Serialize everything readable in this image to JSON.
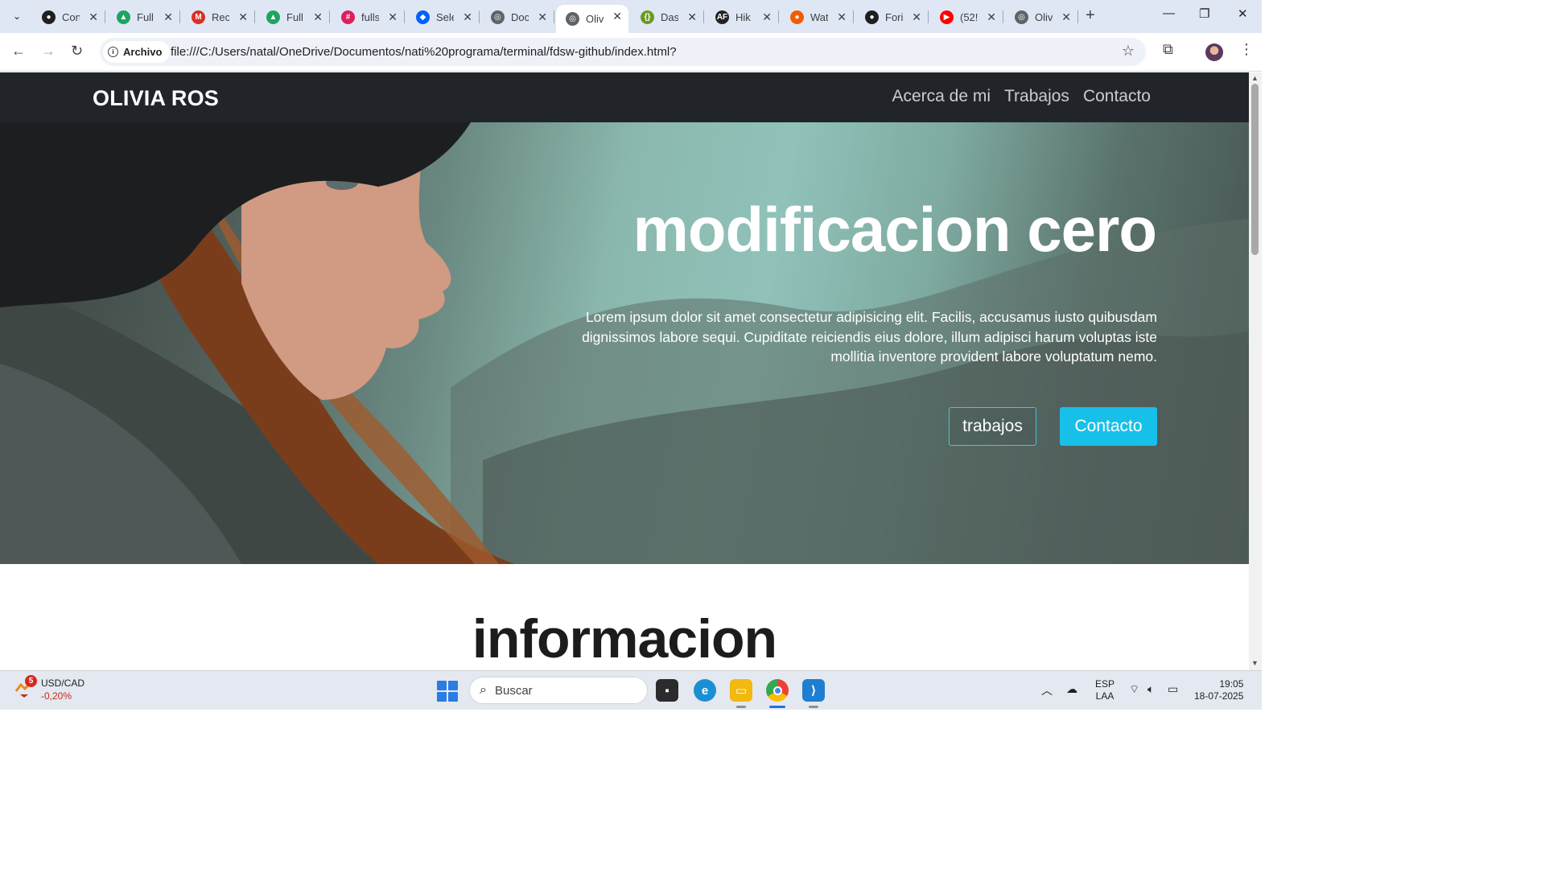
{
  "browser": {
    "tabs": [
      {
        "title": "Con",
        "icon": "github-icon",
        "color": "#1f1f1f",
        "glyph": "●"
      },
      {
        "title": "Full",
        "icon": "google-drive-icon",
        "color": "#1fa463",
        "glyph": "▲"
      },
      {
        "title": "Reci",
        "icon": "gmail-icon",
        "color": "#d93025",
        "glyph": "M"
      },
      {
        "title": "Full",
        "icon": "google-drive-icon",
        "color": "#1fa463",
        "glyph": "▲"
      },
      {
        "title": "fulls",
        "icon": "slack-icon",
        "color": "#e01e5a",
        "glyph": "#"
      },
      {
        "title": "Sele",
        "icon": "dropbox-icon",
        "color": "#0061fe",
        "glyph": "◆"
      },
      {
        "title": "Doc",
        "icon": "globe-icon",
        "color": "#5f6368",
        "glyph": "◎"
      },
      {
        "title": "Oliv",
        "icon": "globe-icon",
        "color": "#5f6368",
        "glyph": "◎",
        "active": true
      },
      {
        "title": "Das",
        "icon": "json-icon",
        "color": "#6a9a1f",
        "glyph": "{}"
      },
      {
        "title": "Hik",
        "icon": "af-icon",
        "color": "#222222",
        "glyph": "AF"
      },
      {
        "title": "Wat",
        "icon": "orange-circle-icon",
        "color": "#f25c05",
        "glyph": "●"
      },
      {
        "title": "Fori",
        "icon": "github-icon",
        "color": "#1f1f1f",
        "glyph": "●"
      },
      {
        "title": "(52!",
        "icon": "youtube-icon",
        "color": "#ff0000",
        "glyph": "▶"
      },
      {
        "title": "Oliv",
        "icon": "globe-icon",
        "color": "#5f6368",
        "glyph": "◎"
      }
    ],
    "security_chip": "Archivo",
    "url": "file:///C:/Users/natal/OneDrive/Documentos/nati%20programa/terminal/fdsw-github/index.html?"
  },
  "site": {
    "brand": "OLIVIA ROS",
    "nav": [
      "Acerca de mi",
      "Trabajos",
      "Contacto"
    ],
    "hero": {
      "title": "modificacion cero",
      "text": "Lorem ipsum dolor sit amet consectetur adipisicing elit. Facilis, accusamus iusto quibusdam dignissimos labore sequi. Cupiditate reiciendis eius dolore, illum adipisci harum voluptas iste mollitia inventore provident labore voluptatum nemo.",
      "btn_outline": "trabajos",
      "btn_fill": "Contacto",
      "accent": "#17c0e8"
    },
    "section_title": "informacion"
  },
  "taskbar": {
    "widget": {
      "badge": "5",
      "pair": "USD/CAD",
      "change": "-0,20%"
    },
    "search_placeholder": "Buscar",
    "lang": [
      "ESP",
      "LAA"
    ],
    "time": "19:05",
    "date": "18-07-2025"
  }
}
